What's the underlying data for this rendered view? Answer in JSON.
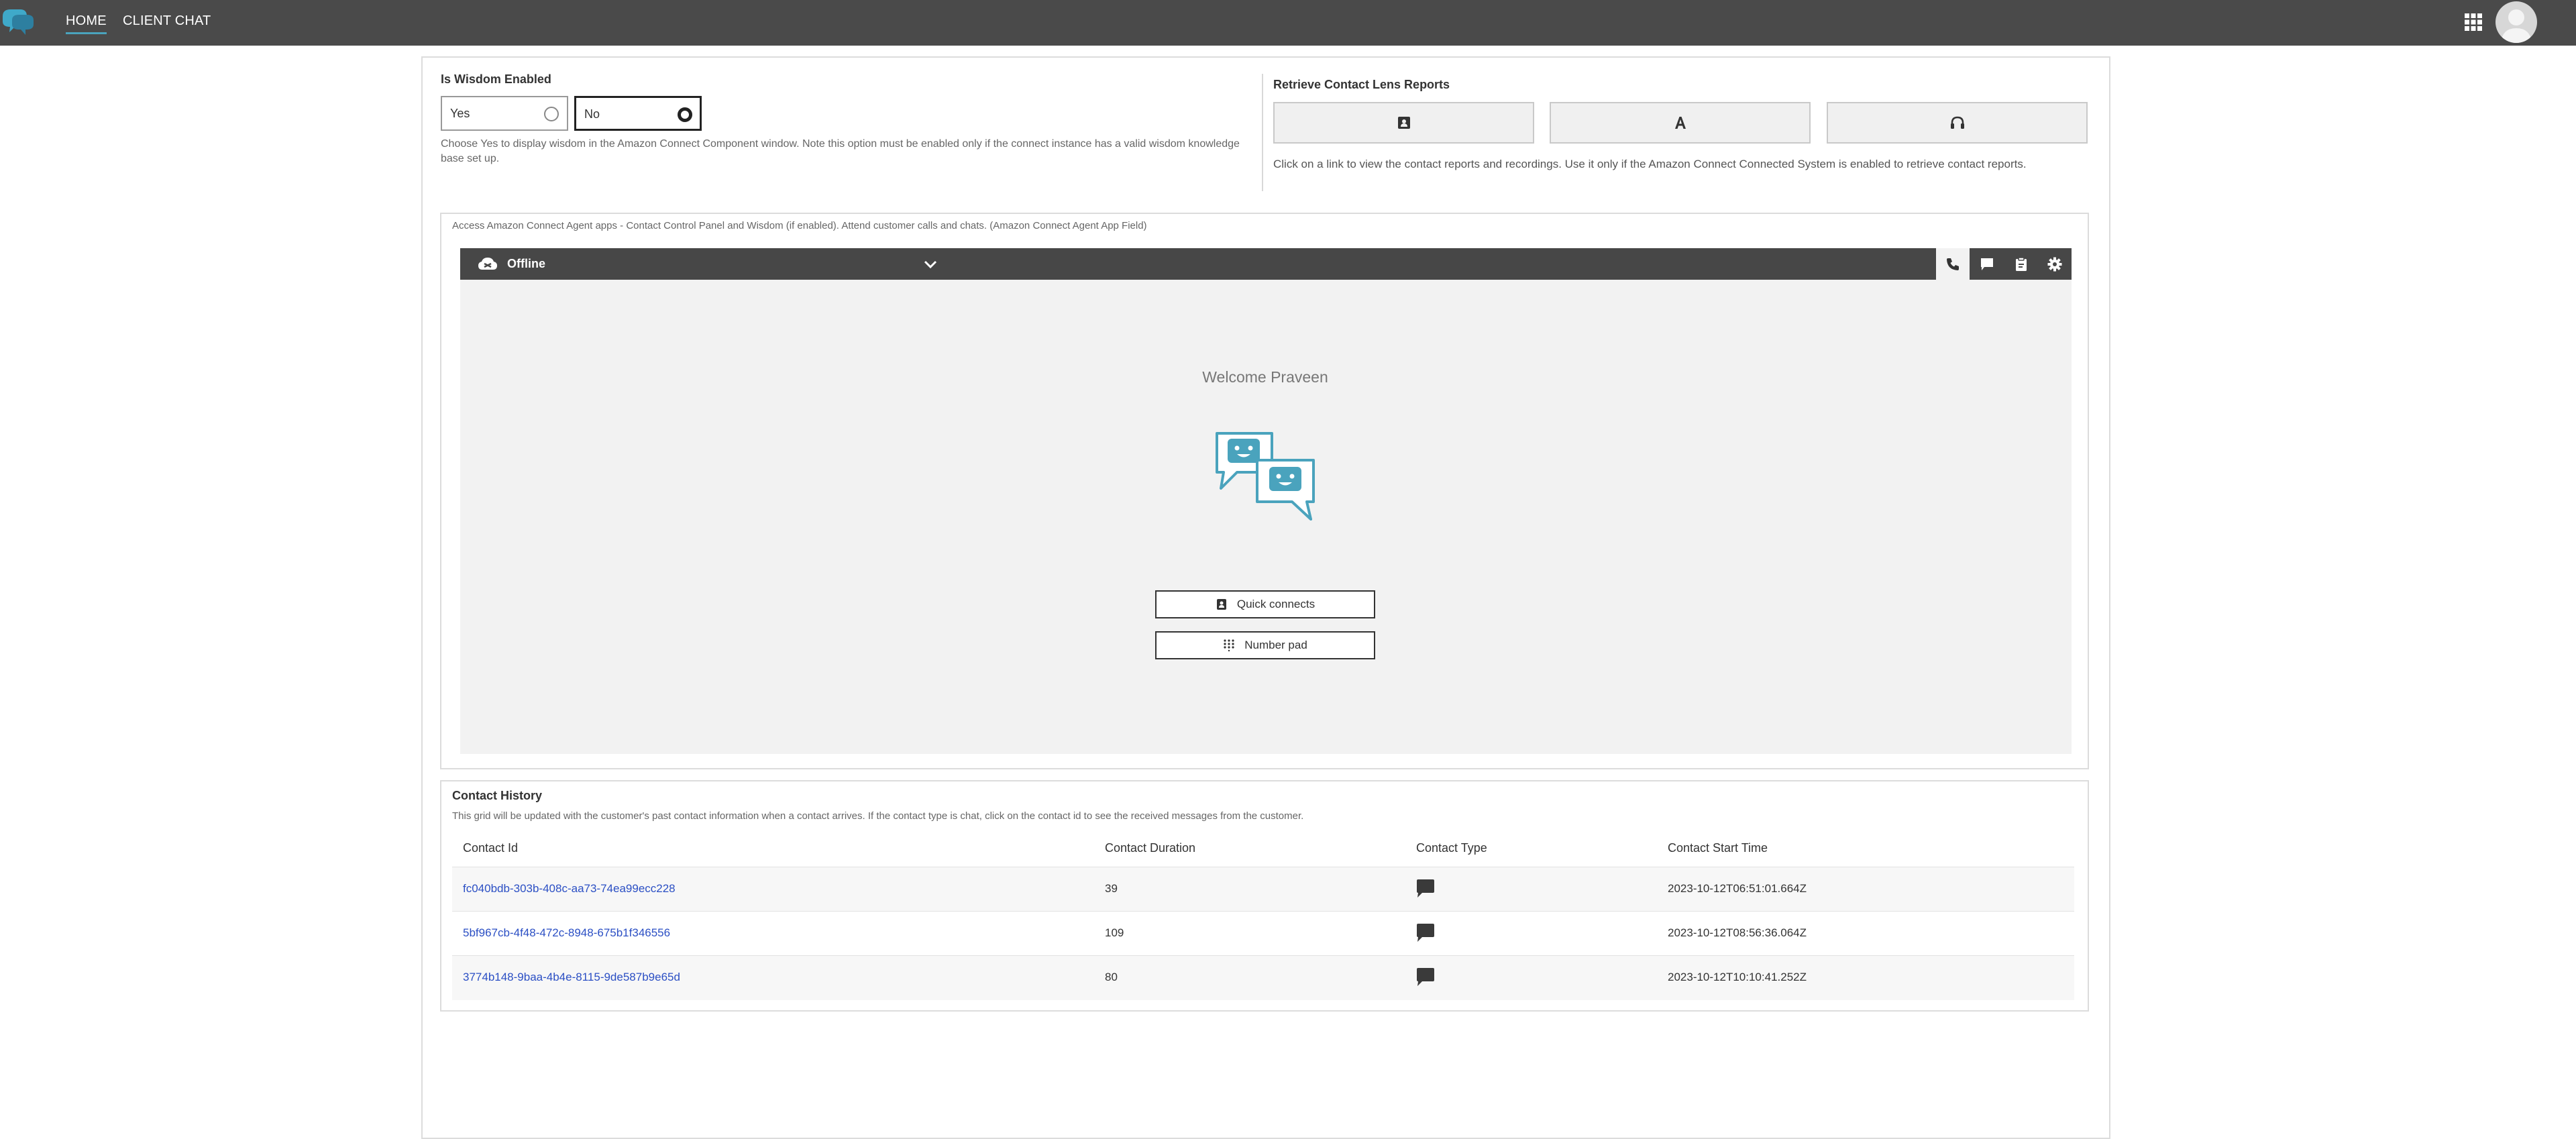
{
  "nav": {
    "tabs": [
      "HOME",
      "CLIENT CHAT"
    ],
    "active_tab": "HOME"
  },
  "wisdom": {
    "title": "Is Wisdom Enabled",
    "options": [
      "Yes",
      "No"
    ],
    "selected": "No",
    "help": "Choose Yes to display wisdom in the Amazon Connect Component window. Note this option must be enabled only if the connect instance has a valid wisdom knowledge base set up."
  },
  "lens": {
    "title": "Retrieve Contact Lens Reports",
    "buttons": [
      {
        "icon": "contact-card-icon"
      },
      {
        "icon": "text-a-icon"
      },
      {
        "icon": "headphones-icon"
      }
    ],
    "help": "Click on a link to view the contact reports and recordings. Use it only if the Amazon Connect Connected System is enabled to retrieve contact reports."
  },
  "ccp": {
    "caption": "Access Amazon Connect Agent apps - Contact Control Panel and Wisdom (if enabled). Attend customer calls and chats. (Amazon Connect Agent App Field)",
    "status": "Offline",
    "welcome": "Welcome Praveen",
    "quick_connects": "Quick connects",
    "number_pad": "Number pad",
    "tabs": [
      "phone-icon",
      "chat-icon",
      "clipboard-icon",
      "settings-icon"
    ],
    "accent": "#4aa3bd"
  },
  "history": {
    "title": "Contact History",
    "help": "This grid will be updated with the customer's past contact information when a contact arrives. If the contact type is chat, click on the contact id to see the received messages from the customer.",
    "columns": [
      "Contact Id",
      "Contact Duration",
      "Contact Type",
      "Contact Start Time"
    ],
    "rows": [
      {
        "id": "fc040bdb-303b-408c-aa73-74ea99ecc228",
        "duration": "39",
        "type": "chat-icon",
        "start": "2023-10-12T06:51:01.664Z"
      },
      {
        "id": "5bf967cb-4f48-472c-8948-675b1f346556",
        "duration": "109",
        "type": "chat-icon",
        "start": "2023-10-12T08:56:36.064Z"
      },
      {
        "id": "3774b148-9baa-4b4e-8115-9de587b9e65d",
        "duration": "80",
        "type": "chat-icon",
        "start": "2023-10-12T10:10:41.252Z"
      }
    ]
  }
}
